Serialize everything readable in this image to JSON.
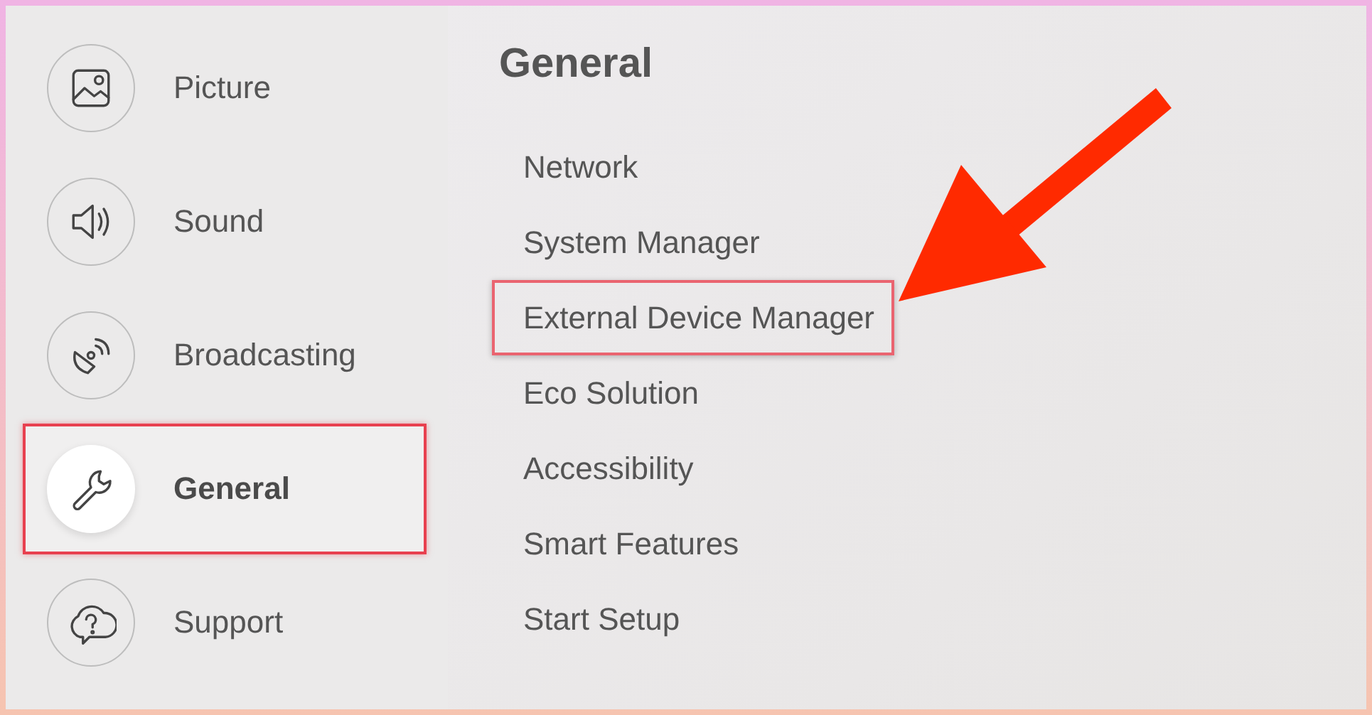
{
  "sidebar": {
    "items": [
      {
        "label": "Picture",
        "selected": false,
        "highlighted": false
      },
      {
        "label": "Sound",
        "selected": false,
        "highlighted": false
      },
      {
        "label": "Broadcasting",
        "selected": false,
        "highlighted": false
      },
      {
        "label": "General",
        "selected": true,
        "highlighted": true
      },
      {
        "label": "Support",
        "selected": false,
        "highlighted": false
      }
    ]
  },
  "panel": {
    "title": "General",
    "items": [
      {
        "label": "Network",
        "highlighted": false
      },
      {
        "label": "System Manager",
        "highlighted": false
      },
      {
        "label": "External Device Manager",
        "highlighted": true
      },
      {
        "label": "Eco Solution",
        "highlighted": false
      },
      {
        "label": "Accessibility",
        "highlighted": false
      },
      {
        "label": "Smart Features",
        "highlighted": false
      },
      {
        "label": "Start Setup",
        "highlighted": false
      }
    ]
  }
}
